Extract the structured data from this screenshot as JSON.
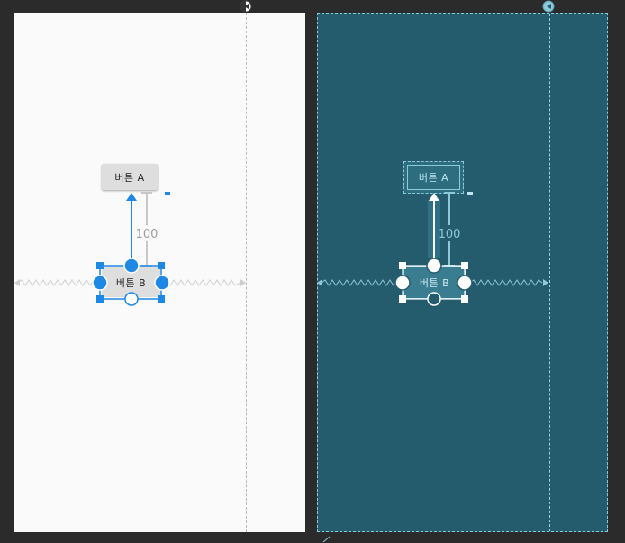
{
  "design": {
    "button_a_label": "버튼 A",
    "button_b_label": "버튼 B",
    "margin_value": "100"
  },
  "blueprint": {
    "button_a_label": "버튼 A",
    "button_b_label": "버튼 B",
    "margin_value": "100"
  },
  "colors": {
    "background": "#2b2b2b",
    "design_canvas": "#fafafa",
    "blueprint_canvas": "#245c6e",
    "selection_accent": "#1e88e5",
    "blueprint_accent": "#8ec9d8"
  },
  "icons": {
    "guideline_handle": "half-filled-circle-icon",
    "selection_anchor": "circle-anchor-icon",
    "resize_handle": "square-handle-icon"
  }
}
